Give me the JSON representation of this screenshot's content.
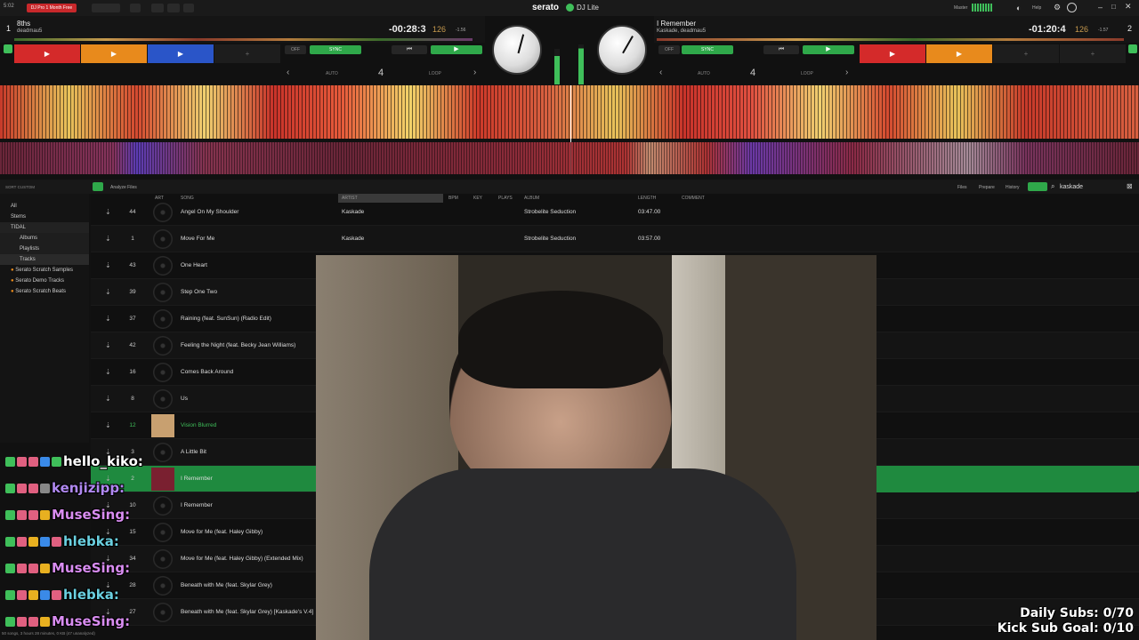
{
  "topbar": {
    "clock": "5:02",
    "promo": "DJ Pro 1 Month Free",
    "brand": "serato",
    "product": "DJ Lite",
    "master_label": "Master",
    "help_label": "Help"
  },
  "deck_left": {
    "number": "1",
    "title": "8ths",
    "artist": "deadmau5",
    "time": "-00:28:3",
    "bpm": "126",
    "pitch": "-1.56",
    "sync_label": "SYNC",
    "off_label": "OFF",
    "auto_label": "AUTO",
    "loop_label": "LOOP",
    "loop_value": "4",
    "cue_colors": [
      "#d42a2a",
      "#e88a1c",
      "#2a55c8"
    ]
  },
  "deck_right": {
    "number": "2",
    "title": "I Remember",
    "artist": "Kaskade, deadmau5",
    "time": "-01:20:4",
    "bpm": "126",
    "pitch": "-1.57",
    "sync_label": "SYNC",
    "off_label": "OFF",
    "auto_label": "AUTO",
    "loop_label": "LOOP",
    "loop_value": "4",
    "cue_colors": [
      "#d42a2a",
      "#e88a1c"
    ]
  },
  "library": {
    "sort_label": "SORT CUSTOM",
    "analyze_label": "Analyze Files",
    "search_value": "kaskade",
    "toolbar_right": [
      "Files",
      "Prepare",
      "History"
    ],
    "sidebar": [
      "All",
      "Stems",
      "TIDAL",
      "Albums",
      "Playlists",
      "Tracks",
      "Serato Scratch Samples",
      "Serato Demo Tracks",
      "Serato Scratch Beats"
    ],
    "columns": {
      "song": "SONG",
      "artist": "ARTIST",
      "bpm": "BPM",
      "key": "KEY",
      "plays": "PLAYS",
      "album": "ALBUM",
      "length": "LENGTH",
      "comment": "COMMENT",
      "art": "ART"
    },
    "tracks": [
      {
        "num": "44",
        "song": "Angel On My Shoulder",
        "artist": "Kaskade",
        "album": "Strobelite Seduction",
        "length": "03:47.00"
      },
      {
        "num": "1",
        "song": "Move For Me",
        "artist": "Kaskade",
        "album": "Strobelite Seduction",
        "length": "03:57.00"
      },
      {
        "num": "43",
        "song": "One Heart",
        "artist": "",
        "album": "",
        "length": ""
      },
      {
        "num": "39",
        "song": "Step One Two",
        "artist": "",
        "album": "",
        "length": ""
      },
      {
        "num": "37",
        "song": "Raining (feat. SunSun) (Radio Edit)",
        "artist": "",
        "album": "",
        "length": ""
      },
      {
        "num": "42",
        "song": "Feeling the Night (feat. Becky Jean Williams)",
        "artist": "",
        "album": "",
        "length": ""
      },
      {
        "num": "16",
        "song": "Comes Back Around",
        "artist": "",
        "album": "",
        "length": ""
      },
      {
        "num": "8",
        "song": "Us",
        "artist": "",
        "album": "",
        "length": ""
      },
      {
        "num": "12",
        "song": "Vision Blurred",
        "artist": "",
        "album": "",
        "length": ""
      },
      {
        "num": "3",
        "song": "A Little Bit",
        "artist": "",
        "album": "",
        "length": ""
      },
      {
        "num": "2",
        "song": "I Remember",
        "artist": "",
        "album": "",
        "length": ""
      },
      {
        "num": "10",
        "song": "I Remember",
        "artist": "",
        "album": "",
        "length": ""
      },
      {
        "num": "15",
        "song": "Move for Me (feat. Haley Gibby)",
        "artist": "",
        "album": "",
        "length": ""
      },
      {
        "num": "34",
        "song": "Move for Me (feat. Haley Gibby) (Extended Mix)",
        "artist": "",
        "album": "",
        "length": ""
      },
      {
        "num": "28",
        "song": "Beneath with Me (feat. Skylar Grey)",
        "artist": "",
        "album": "",
        "length": ""
      },
      {
        "num": "27",
        "song": "Beneath with Me (feat. Skylar Grey) [Kaskade's V.4]",
        "artist": "",
        "album": "",
        "length": ""
      }
    ],
    "status": "50 songs, 3 hours 28 minutes, 0 KB (47 unanalyzed)"
  },
  "chat": [
    {
      "user": "hello_kiko:",
      "color": "#ffffff"
    },
    {
      "user": "kenjizipp:",
      "color": "#b088f0"
    },
    {
      "user": "MuseSing:",
      "color": "#d88cf0"
    },
    {
      "user": "hlebka:",
      "color": "#6ad0e0"
    },
    {
      "user": "MuseSing:",
      "color": "#d88cf0"
    },
    {
      "user": "hlebka:",
      "color": "#6ad0e0"
    },
    {
      "user": "MuseSing:",
      "color": "#d88cf0"
    }
  ],
  "goals": {
    "daily_subs": "Daily Subs: 0/70",
    "kick_goal": "Kick Sub Goal: 0/10"
  }
}
